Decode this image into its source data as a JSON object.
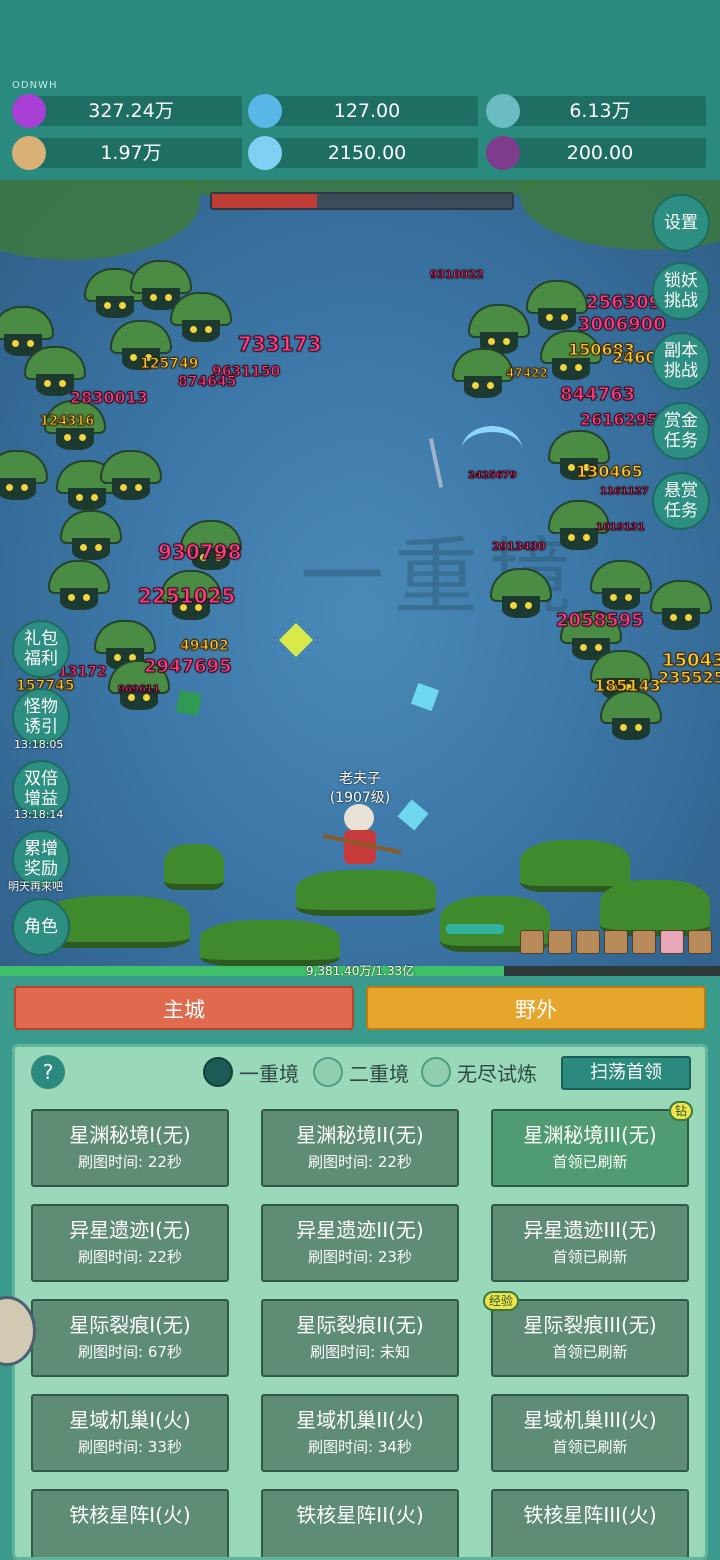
{
  "topbar": {
    "tag": "ODNWH",
    "resources": [
      {
        "icon": "purple-gem-icon",
        "value": "327.24万"
      },
      {
        "icon": "blue-crystal-icon",
        "value": "127.00"
      },
      {
        "icon": "bowl-orb-icon",
        "value": "6.13万"
      },
      {
        "icon": "scroll-icon",
        "value": "1.97万"
      },
      {
        "icon": "ice-cube-icon",
        "value": "2150.00"
      },
      {
        "icon": "pot-icon",
        "value": "200.00"
      }
    ]
  },
  "battle": {
    "watermark": "一重境",
    "boss_health_fraction": 0.35,
    "hero": {
      "name": "老夫子",
      "level": "(1907级)"
    },
    "xp_text": "9,381.40万/1.33亿",
    "xp_fraction": 0.7,
    "damage": [
      {
        "text": "733173",
        "c": "p",
        "s": 20
      },
      {
        "text": "9310022",
        "c": "p",
        "s": 11
      },
      {
        "text": "2563092",
        "c": "p",
        "s": 18
      },
      {
        "text": "3006900",
        "c": "p",
        "s": 18
      },
      {
        "text": "150683",
        "c": "y",
        "s": 16
      },
      {
        "text": "2460",
        "c": "y",
        "s": 16
      },
      {
        "text": "125749",
        "c": "y",
        "s": 14
      },
      {
        "text": "9631150",
        "c": "p",
        "s": 14
      },
      {
        "text": "874645",
        "c": "p",
        "s": 14
      },
      {
        "text": "2830013",
        "c": "p",
        "s": 16
      },
      {
        "text": "124316",
        "c": "y",
        "s": 13
      },
      {
        "text": "844763",
        "c": "p",
        "s": 18
      },
      {
        "text": "2616295",
        "c": "p",
        "s": 16
      },
      {
        "text": "130465",
        "c": "y",
        "s": 16
      },
      {
        "text": "930798",
        "c": "p",
        "s": 20
      },
      {
        "text": "2251025",
        "c": "p",
        "s": 20
      },
      {
        "text": "2913430",
        "c": "p",
        "s": 11
      },
      {
        "text": "2058595",
        "c": "p",
        "s": 18
      },
      {
        "text": "49402",
        "c": "y",
        "s": 14
      },
      {
        "text": "2947695",
        "c": "p",
        "s": 18
      },
      {
        "text": "13172",
        "c": "p",
        "s": 14
      },
      {
        "text": "157745",
        "c": "y",
        "s": 14
      },
      {
        "text": "185143",
        "c": "y",
        "s": 16
      },
      {
        "text": "15043",
        "c": "y",
        "s": 18
      },
      {
        "text": "235525",
        "c": "y",
        "s": 16
      },
      {
        "text": "47422",
        "c": "y",
        "s": 12
      },
      {
        "text": "2425679",
        "c": "p",
        "s": 10
      },
      {
        "text": "1161127",
        "c": "p",
        "s": 10
      },
      {
        "text": "1019131",
        "c": "p",
        "s": 10
      },
      {
        "text": "969611",
        "c": "p",
        "s": 10
      }
    ],
    "right_buttons": [
      "设置",
      "锁妖挑战",
      "副本挑战",
      "赏金任务",
      "悬赏任务"
    ],
    "left_buttons": [
      {
        "label": "礼包福利",
        "timer": ""
      },
      {
        "label": "怪物诱引",
        "timer": "13:18:05"
      },
      {
        "label": "双倍增益",
        "timer": "13:18:14"
      },
      {
        "label": "累增奖励",
        "timer": "明天再来吧"
      },
      {
        "label": "角色",
        "timer": ""
      }
    ]
  },
  "panel": {
    "main_city": "主城",
    "wild": "野外",
    "help": "?",
    "tabs": [
      {
        "label": "一重境",
        "selected": true
      },
      {
        "label": "二重境",
        "selected": false
      },
      {
        "label": "无尽试炼",
        "selected": false
      }
    ],
    "sweep": "扫荡首领",
    "cards": [
      {
        "title": "星渊秘境I(无)",
        "sub": "刷图时间: 22秒",
        "badge": ""
      },
      {
        "title": "星渊秘境II(无)",
        "sub": "刷图时间: 22秒",
        "badge": ""
      },
      {
        "title": "星渊秘境III(无)",
        "sub": "首领已刷新",
        "badge": "钻"
      },
      {
        "title": "异星遗迹I(无)",
        "sub": "刷图时间: 22秒",
        "badge": ""
      },
      {
        "title": "异星遗迹II(无)",
        "sub": "刷图时间: 23秒",
        "badge": ""
      },
      {
        "title": "异星遗迹III(无)",
        "sub": "首领已刷新",
        "badge": ""
      },
      {
        "title": "星际裂痕I(无)",
        "sub": "刷图时间: 67秒",
        "badge": ""
      },
      {
        "title": "星际裂痕II(无)",
        "sub": "刷图时间: 未知",
        "badge": ""
      },
      {
        "title": "星际裂痕III(无)",
        "sub": "首领已刷新",
        "badge": "经验"
      },
      {
        "title": "星域机巢I(火)",
        "sub": "刷图时间: 33秒",
        "badge": ""
      },
      {
        "title": "星域机巢II(火)",
        "sub": "刷图时间: 34秒",
        "badge": ""
      },
      {
        "title": "星域机巢III(火)",
        "sub": "首领已刷新",
        "badge": ""
      },
      {
        "title": "铁核星阵I(火)",
        "sub": "",
        "badge": ""
      },
      {
        "title": "铁核星阵II(火)",
        "sub": "",
        "badge": ""
      },
      {
        "title": "铁核星阵III(火)",
        "sub": "",
        "badge": ""
      }
    ]
  }
}
